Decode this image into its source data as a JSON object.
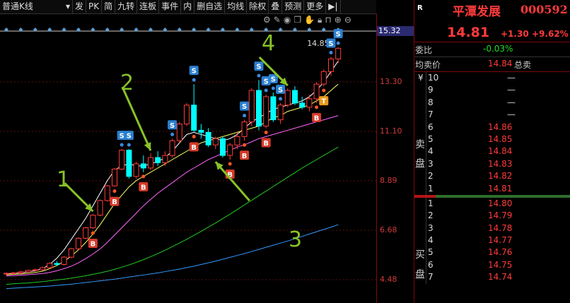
{
  "toolbar": {
    "period_select": "普通K线",
    "items": [
      "发",
      "PK",
      "简",
      "九转",
      "连板",
      "事件",
      "内",
      "删自选",
      "均线",
      "除权",
      "叠",
      "预测",
      "更多",
      "▶|"
    ]
  },
  "icons": [
    "gear-icon",
    "pen-icon",
    "eye-icon",
    "copy-icon",
    "hand-icon",
    "lock-icon",
    "lock-open-icon",
    "plus-icon",
    "minus-icon"
  ],
  "colors": {
    "rise": "#ff3b3b",
    "fall": "#00ffff",
    "ma5": "#ffffff",
    "ma10": "#ffff66",
    "ma20": "#ff66ff",
    "ma60": "#22cc22",
    "ma120": "#3399ff",
    "annotation": "#88c227"
  },
  "price_axis": {
    "top_value": "15.32",
    "labels": [
      "13.30",
      "11.10",
      "8.89",
      "6.68",
      "4.48"
    ]
  },
  "chart_data": {
    "type": "candlestick",
    "ylim": [
      3.0,
      16.0
    ],
    "max_label": "14.85",
    "candles": [
      {
        "o": 4.05,
        "h": 4.12,
        "l": 3.98,
        "c": 4.08
      },
      {
        "o": 4.08,
        "h": 4.15,
        "l": 4.02,
        "c": 4.1
      },
      {
        "o": 4.1,
        "h": 4.2,
        "l": 4.05,
        "c": 4.15
      },
      {
        "o": 4.15,
        "h": 4.25,
        "l": 4.1,
        "c": 4.22
      },
      {
        "o": 4.22,
        "h": 4.3,
        "l": 4.15,
        "c": 4.25
      },
      {
        "o": 4.25,
        "h": 4.4,
        "l": 4.2,
        "c": 4.35
      },
      {
        "o": 4.35,
        "h": 4.6,
        "l": 4.3,
        "c": 4.55
      },
      {
        "o": 4.55,
        "h": 4.65,
        "l": 4.45,
        "c": 4.5
      },
      {
        "o": 4.5,
        "h": 4.9,
        "l": 4.45,
        "c": 4.85
      },
      {
        "o": 4.85,
        "h": 5.3,
        "l": 4.8,
        "c": 5.25
      },
      {
        "o": 5.25,
        "h": 5.8,
        "l": 5.2,
        "c": 5.75
      },
      {
        "o": 5.75,
        "h": 6.3,
        "l": 5.7,
        "c": 6.25
      },
      {
        "o": 6.25,
        "h": 6.9,
        "l": 6.2,
        "c": 6.85
      },
      {
        "o": 6.85,
        "h": 7.6,
        "l": 6.8,
        "c": 7.55
      },
      {
        "o": 7.55,
        "h": 8.3,
        "l": 7.5,
        "c": 8.25
      },
      {
        "o": 8.25,
        "h": 9.1,
        "l": 8.2,
        "c": 9.05
      },
      {
        "o": 9.05,
        "h": 10.0,
        "l": 9.0,
        "c": 9.95
      },
      {
        "o": 9.95,
        "h": 10.0,
        "l": 8.6,
        "c": 8.7
      },
      {
        "o": 8.7,
        "h": 9.4,
        "l": 8.6,
        "c": 9.3
      },
      {
        "o": 9.3,
        "h": 9.7,
        "l": 8.9,
        "c": 9.1
      },
      {
        "o": 9.1,
        "h": 9.8,
        "l": 9.0,
        "c": 9.6
      },
      {
        "o": 9.6,
        "h": 9.9,
        "l": 9.2,
        "c": 9.35
      },
      {
        "o": 9.35,
        "h": 9.9,
        "l": 9.2,
        "c": 9.7
      },
      {
        "o": 9.7,
        "h": 10.5,
        "l": 9.6,
        "c": 10.4
      },
      {
        "o": 10.4,
        "h": 11.3,
        "l": 10.3,
        "c": 11.2
      },
      {
        "o": 11.2,
        "h": 12.2,
        "l": 11.1,
        "c": 12.1
      },
      {
        "o": 12.1,
        "h": 13.1,
        "l": 10.8,
        "c": 10.9
      },
      {
        "o": 10.9,
        "h": 11.2,
        "l": 10.5,
        "c": 10.8
      },
      {
        "o": 10.8,
        "h": 11.0,
        "l": 10.1,
        "c": 10.2
      },
      {
        "o": 10.2,
        "h": 10.6,
        "l": 10.0,
        "c": 10.5
      },
      {
        "o": 10.5,
        "h": 10.6,
        "l": 9.6,
        "c": 9.7
      },
      {
        "o": 9.7,
        "h": 10.3,
        "l": 9.5,
        "c": 10.2
      },
      {
        "o": 10.2,
        "h": 10.8,
        "l": 10.0,
        "c": 10.6
      },
      {
        "o": 10.6,
        "h": 11.4,
        "l": 10.4,
        "c": 11.3
      },
      {
        "o": 11.3,
        "h": 12.9,
        "l": 11.1,
        "c": 12.8
      },
      {
        "o": 12.8,
        "h": 13.3,
        "l": 10.9,
        "c": 11.1
      },
      {
        "o": 11.1,
        "h": 12.6,
        "l": 11.0,
        "c": 12.5
      },
      {
        "o": 12.5,
        "h": 12.7,
        "l": 11.3,
        "c": 11.4
      },
      {
        "o": 11.4,
        "h": 12.2,
        "l": 11.2,
        "c": 12.1
      },
      {
        "o": 12.1,
        "h": 12.9,
        "l": 12.0,
        "c": 12.8
      },
      {
        "o": 12.8,
        "h": 13.0,
        "l": 12.1,
        "c": 12.2
      },
      {
        "o": 12.2,
        "h": 12.5,
        "l": 11.9,
        "c": 12.0
      },
      {
        "o": 12.0,
        "h": 12.6,
        "l": 11.8,
        "c": 12.4
      },
      {
        "o": 12.4,
        "h": 13.2,
        "l": 12.2,
        "c": 13.1
      },
      {
        "o": 13.1,
        "h": 13.8,
        "l": 13.0,
        "c": 13.7
      },
      {
        "o": 13.7,
        "h": 14.4,
        "l": 13.5,
        "c": 14.3
      },
      {
        "o": 14.3,
        "h": 14.85,
        "l": 14.1,
        "c": 14.81
      }
    ],
    "ma_series": [
      {
        "name": "MA5",
        "values": [
          4.05,
          4.08,
          4.1,
          4.15,
          4.2,
          4.3,
          4.5,
          4.8,
          5.2,
          5.7,
          6.2,
          6.7,
          7.3,
          7.9,
          8.5,
          9.0,
          9.2,
          9.3,
          9.2,
          9.2,
          9.3,
          9.4,
          9.6,
          9.9,
          10.3,
          10.7,
          10.8,
          10.7,
          10.6,
          10.5,
          10.4,
          10.5,
          10.7,
          11.0,
          11.3,
          11.5,
          11.7,
          11.9,
          12.0,
          12.1,
          12.2,
          12.3,
          12.5,
          12.8,
          13.2,
          13.7,
          14.2
        ]
      },
      {
        "name": "MA10",
        "values": [
          4.0,
          4.03,
          4.05,
          4.08,
          4.12,
          4.18,
          4.3,
          4.45,
          4.65,
          4.9,
          5.2,
          5.55,
          5.95,
          6.4,
          6.9,
          7.4,
          7.8,
          8.2,
          8.5,
          8.7,
          8.9,
          9.1,
          9.3,
          9.5,
          9.7,
          9.9,
          10.1,
          10.3,
          10.4,
          10.5,
          10.6,
          10.7,
          10.8,
          10.9,
          11.0,
          11.1,
          11.3,
          11.5,
          11.6,
          11.8,
          11.9,
          12.0,
          12.1,
          12.3,
          12.5,
          12.8,
          13.1
        ]
      },
      {
        "name": "MA20",
        "values": [
          3.95,
          3.97,
          3.99,
          4.01,
          4.04,
          4.07,
          4.12,
          4.2,
          4.3,
          4.42,
          4.58,
          4.78,
          5.0,
          5.25,
          5.55,
          5.9,
          6.25,
          6.6,
          6.95,
          7.3,
          7.6,
          7.9,
          8.15,
          8.4,
          8.65,
          8.9,
          9.1,
          9.3,
          9.5,
          9.65,
          9.8,
          9.95,
          10.1,
          10.2,
          10.35,
          10.5,
          10.6,
          10.7,
          10.8,
          10.9,
          11.0,
          11.1,
          11.2,
          11.3,
          11.4,
          11.5,
          11.6
        ]
      },
      {
        "name": "MA60",
        "values": [
          3.55,
          3.58,
          3.6,
          3.62,
          3.65,
          3.68,
          3.72,
          3.76,
          3.8,
          3.85,
          3.9,
          3.96,
          4.03,
          4.1,
          4.18,
          4.27,
          4.37,
          4.48,
          4.6,
          4.73,
          4.87,
          5.02,
          5.18,
          5.35,
          5.52,
          5.7,
          5.89,
          6.08,
          6.28,
          6.48,
          6.69,
          6.9,
          7.12,
          7.34,
          7.56,
          7.78,
          8.0,
          8.22,
          8.44,
          8.66,
          8.88,
          9.1,
          9.3,
          9.5,
          9.7,
          9.9,
          10.1
        ]
      },
      {
        "name": "MA120",
        "values": [
          3.35,
          3.37,
          3.39,
          3.41,
          3.43,
          3.45,
          3.47,
          3.5,
          3.53,
          3.56,
          3.6,
          3.64,
          3.68,
          3.72,
          3.76,
          3.8,
          3.85,
          3.9,
          3.95,
          4.0,
          4.05,
          4.1,
          4.16,
          4.22,
          4.28,
          4.35,
          4.42,
          4.5,
          4.58,
          4.66,
          4.75,
          4.84,
          4.93,
          5.02,
          5.12,
          5.22,
          5.32,
          5.42,
          5.52,
          5.62,
          5.73,
          5.84,
          5.95,
          6.06,
          6.17,
          6.28,
          6.4
        ]
      }
    ],
    "signals": [
      {
        "i": 12,
        "type": "B"
      },
      {
        "i": 15,
        "type": "B"
      },
      {
        "i": 19,
        "type": "B"
      },
      {
        "i": 26,
        "type": "B"
      },
      {
        "i": 31,
        "type": "B"
      },
      {
        "i": 33,
        "type": "B"
      },
      {
        "i": 36,
        "type": "B"
      },
      {
        "i": 43,
        "type": "B"
      },
      {
        "i": 44,
        "type": "T"
      },
      {
        "i": 16,
        "type": "S"
      },
      {
        "i": 17,
        "type": "S"
      },
      {
        "i": 23,
        "type": "S"
      },
      {
        "i": 26,
        "type": "S"
      },
      {
        "i": 33,
        "type": "S"
      },
      {
        "i": 35,
        "type": "S"
      },
      {
        "i": 36,
        "type": "S"
      },
      {
        "i": 37,
        "type": "S"
      },
      {
        "i": 38,
        "type": "S"
      },
      {
        "i": 45,
        "type": "S"
      },
      {
        "i": 46,
        "type": "S"
      }
    ],
    "annotations": [
      {
        "label": "1",
        "candle": 12
      },
      {
        "label": "2",
        "candle": 20
      },
      {
        "label": "3",
        "candle": 29
      },
      {
        "label": "4",
        "candle": 39
      }
    ]
  },
  "quote": {
    "badge": "R",
    "name": "平潭发展",
    "code": "000592",
    "price": "14.81",
    "change": "+1.30",
    "change_pct": "+9.62%",
    "weibi_label": "委比",
    "weibi_value": "-0.03%",
    "avg_label": "均卖价",
    "avg_value": "14.84",
    "total_sell_label": "总卖"
  },
  "order_book": {
    "yen_row": {
      "level": "¥",
      "sub": "10",
      "vol": "—"
    },
    "sell_label_1": "卖",
    "sell_label_2": "盘",
    "buy_label_1": "买",
    "buy_label_2": "盘",
    "sell": [
      {
        "level": "9",
        "price": "",
        "vol": "—"
      },
      {
        "level": "8",
        "price": "",
        "vol": "—"
      },
      {
        "level": "7",
        "price": "",
        "vol": "—"
      },
      {
        "level": "6",
        "price": "14.86",
        "vol": ""
      },
      {
        "level": "5",
        "price": "14.85",
        "vol": ""
      },
      {
        "level": "4",
        "price": "14.84",
        "vol": ""
      },
      {
        "level": "3",
        "price": "14.83",
        "vol": ""
      },
      {
        "level": "2",
        "price": "14.82",
        "vol": ""
      },
      {
        "level": "1",
        "price": "14.81",
        "vol": ""
      }
    ],
    "buy": [
      {
        "level": "1",
        "price": "14.80"
      },
      {
        "level": "2",
        "price": "14.79"
      },
      {
        "level": "3",
        "price": "14.78"
      },
      {
        "level": "4",
        "price": "14.77"
      },
      {
        "level": "5",
        "price": "14.76"
      },
      {
        "level": "6",
        "price": "14.75"
      },
      {
        "level": "7",
        "price": "14.74"
      }
    ]
  }
}
